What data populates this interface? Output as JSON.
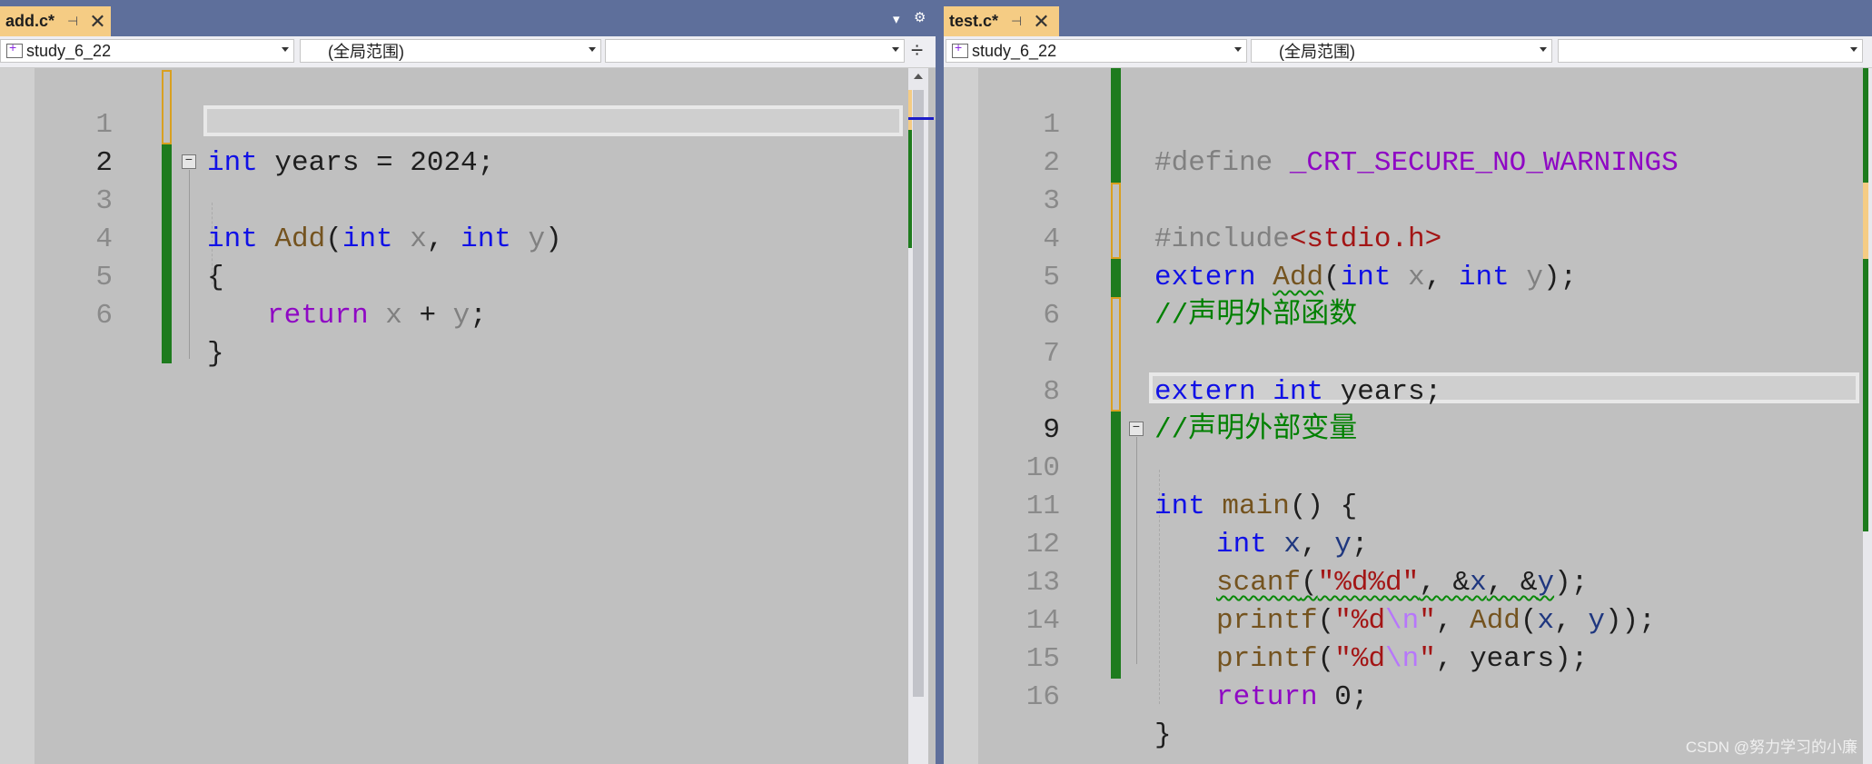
{
  "left": {
    "tab": {
      "title": "add.c*",
      "pin": "⊣",
      "close": "✕"
    },
    "tabstrip_tools": {
      "dropdown": "▾",
      "settings": "⚙"
    },
    "nav": {
      "project": "study_6_22",
      "scope": "(全局范围)",
      "member": "",
      "split": "÷"
    },
    "line_numbers": [
      "1",
      "2",
      "3",
      "4",
      "5",
      "6"
    ],
    "code": {
      "l1": {
        "kw": "int",
        "rest": " years = 2024;"
      },
      "l3": {
        "kw1": "int",
        "fn": "Add",
        "p1": "(",
        "kw2": "int",
        "x": "x",
        "comma": ", ",
        "kw3": "int",
        "y": "y",
        "p2": ")"
      },
      "l4": "{",
      "l5": {
        "kw": "return",
        "x": "x",
        "op": " + ",
        "y": "y",
        "semi": ";"
      },
      "l6": "}"
    },
    "collapse_symbol": "−"
  },
  "right": {
    "tab": {
      "title": "test.c*",
      "pin": "⊣",
      "close": "✕"
    },
    "nav": {
      "project": "study_6_22",
      "scope": "(全局范围)",
      "member": ""
    },
    "line_numbers": [
      "1",
      "2",
      "3",
      "4",
      "5",
      "6",
      "7",
      "8",
      "9",
      "10",
      "11",
      "12",
      "13",
      "14",
      "15",
      "16"
    ],
    "code": {
      "l1": {
        "pp": "#define ",
        "macro": "_CRT_SECURE_NO_WARNINGS"
      },
      "l3": {
        "pp": "#include",
        "str": "<stdio.h>"
      },
      "l4": {
        "kw1": "extern ",
        "fn": "Add",
        "p1": "(",
        "kw2": "int",
        "x": "x",
        "comma": ", ",
        "kw3": "int",
        "y": "y",
        "p2": ");"
      },
      "l5": "//声明外部函数",
      "l7": {
        "kw1": "extern ",
        "kw2": "int",
        "rest": " years;"
      },
      "l8": "//声明外部变量",
      "l10": {
        "kw": "int",
        "fn": "main",
        "rest": "() {"
      },
      "l11": {
        "kw": "int",
        "x": "x",
        "comma": ", ",
        "y": "y",
        "semi": ";"
      },
      "l12": {
        "fn": "scanf",
        "p1": "(",
        "str": "\"%d%d\"",
        "mid": ", &",
        "x": "x",
        "mid2": ", &",
        "y": "y",
        "p2": ");"
      },
      "l13": {
        "fn": "printf",
        "p1": "(",
        "str1": "\"%d",
        "esc": "\\n",
        "str2": "\"",
        "mid": ", ",
        "fn2": "Add",
        "p2": "(",
        "x": "x",
        "comma": ", ",
        "y": "y",
        "p3": "));"
      },
      "l14": {
        "fn": "printf",
        "p1": "(",
        "str1": "\"%d",
        "esc": "\\n",
        "str2": "\"",
        "rest": ", years);"
      },
      "l15": {
        "kw": "return",
        "rest": " 0;"
      },
      "l16": "}"
    },
    "collapse_symbol": "−"
  },
  "watermark": "CSDN @努力学习的小廉",
  "colors": {
    "keyword": "#1010e6",
    "function": "#74531f",
    "comment": "#008000",
    "string": "#a31515",
    "macro": "#8f08c4",
    "tab": "#f5cc84",
    "chrome": "#5e6f9b"
  }
}
